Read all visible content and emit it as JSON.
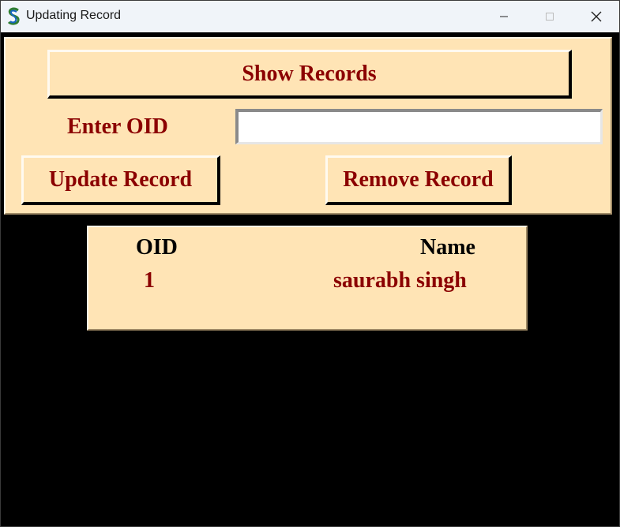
{
  "window": {
    "title": "Updating Record",
    "controls": {
      "minimize": "minimize",
      "maximize": "maximize",
      "close": "close"
    }
  },
  "form": {
    "show_records_label": "Show Records",
    "enter_oid_label": "Enter OID",
    "oid_value": "",
    "update_label": "Update Record",
    "remove_label": "Remove Record"
  },
  "records": {
    "columns": [
      "OID",
      "Name"
    ],
    "rows": [
      {
        "oid": "1",
        "name": "saurabh singh"
      }
    ]
  },
  "colors": {
    "panel_bg": "#ffe4b5",
    "label_text": "#8b0000",
    "header_text": "#000000",
    "window_bg": "#000000"
  }
}
